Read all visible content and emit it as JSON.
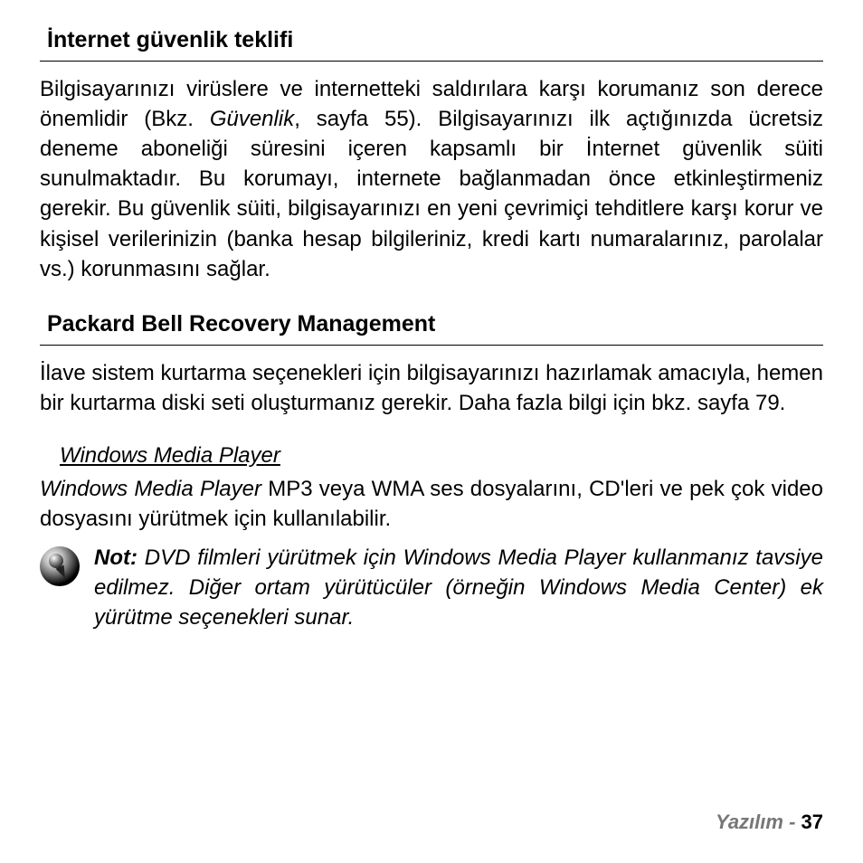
{
  "section1": {
    "heading": "İnternet güvenlik teklifi",
    "para_before": "Bilgisayarınızı virüslere ve internetteki saldırılara karşı korumanız son derece önemlidir (Bkz. ",
    "para_ref": "Güvenlik",
    "para_after": ", sayfa 55). Bilgisayarınızı ilk açtığınızda ücretsiz deneme aboneliği süresini içeren kapsamlı bir İnternet güvenlik süiti sunulmaktadır. Bu korumayı, internete bağlanmadan önce etkinleştirmeniz gerekir. Bu güvenlik süiti, bilgisayarınızı en yeni çevrimiçi tehditlere karşı korur ve kişisel verilerinizin (banka hesap bilgileriniz, kredi kartı numaralarınız, parolalar vs.) korunmasını sağlar."
  },
  "section2": {
    "heading": "Packard Bell Recovery Management",
    "para": "İlave sistem kurtarma seçenekleri için bilgisayarınızı hazırlamak amacıyla, hemen bir kurtarma diski seti oluşturmanız gerekir. Daha fazla bilgi için bkz. sayfa 79."
  },
  "wmp": {
    "heading": "Windows Media Player",
    "para_emph": "Windows Media Player",
    "para_rest": " MP3 veya WMA ses dosyalarını, CD'leri ve pek çok video dosyasını yürütmek için kullanılabilir."
  },
  "note": {
    "label": "Not:",
    "text": " DVD filmleri yürütmek için Windows Media Player kullanmanız tavsiye edilmez. Diğer ortam yürütücüler (örneğin Windows Media Center) ek yürütme seçenekleri sunar."
  },
  "footer": {
    "label": "Yazılım - ",
    "page": " 37"
  }
}
